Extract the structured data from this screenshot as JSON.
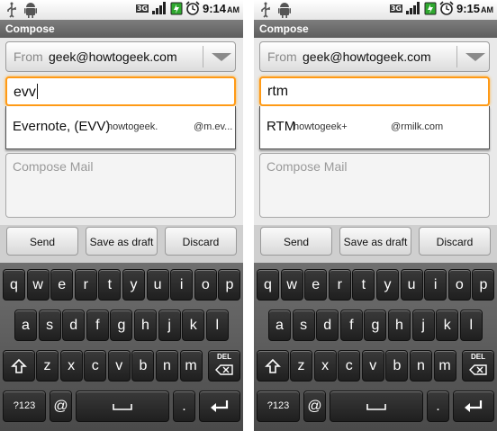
{
  "screens": [
    {
      "status": {
        "network": "3G",
        "time": "9:14",
        "ampm": "AM"
      },
      "title": "Compose",
      "from": {
        "label": "From",
        "value": "geek@howtogeek.com"
      },
      "to": {
        "value": "evv"
      },
      "suggestion": {
        "name": "Evernote, (EVV)",
        "domain": "howtogeek.",
        "email": "@m.ev..."
      },
      "body": {
        "placeholder": "Compose Mail"
      },
      "actions": {
        "send": "Send",
        "save": "Save as draft",
        "discard": "Discard"
      }
    },
    {
      "status": {
        "network": "3G",
        "time": "9:15",
        "ampm": "AM"
      },
      "title": "Compose",
      "from": {
        "label": "From",
        "value": "geek@howtogeek.com"
      },
      "to": {
        "value": "rtm"
      },
      "suggestion": {
        "name": "RTM",
        "domain": "howtogeek+",
        "email": "@rmilk.com"
      },
      "body": {
        "placeholder": "Compose Mail"
      },
      "actions": {
        "send": "Send",
        "save": "Save as draft",
        "discard": "Discard"
      }
    }
  ],
  "keyboard": {
    "row1": [
      "q",
      "w",
      "e",
      "r",
      "t",
      "y",
      "u",
      "i",
      "o",
      "p"
    ],
    "row2": [
      "a",
      "s",
      "d",
      "f",
      "g",
      "h",
      "j",
      "k",
      "l"
    ],
    "row3": [
      "z",
      "x",
      "c",
      "v",
      "b",
      "n",
      "m"
    ],
    "del_label": "DEL",
    "sym_label": "?123",
    "at_label": "@",
    "period_label": "."
  },
  "icons": [
    "usb-icon",
    "android-icon",
    "signal-icon",
    "battery-icon",
    "alarm-icon",
    "dropdown-arrow-icon",
    "shift-icon",
    "space-icon",
    "enter-icon",
    "delete-icon"
  ],
  "colors": {
    "focus": "#ff9a16",
    "keyboard_bg": "#555555",
    "key": "#2b2b2b",
    "title_bar": "#6e6e6e"
  }
}
